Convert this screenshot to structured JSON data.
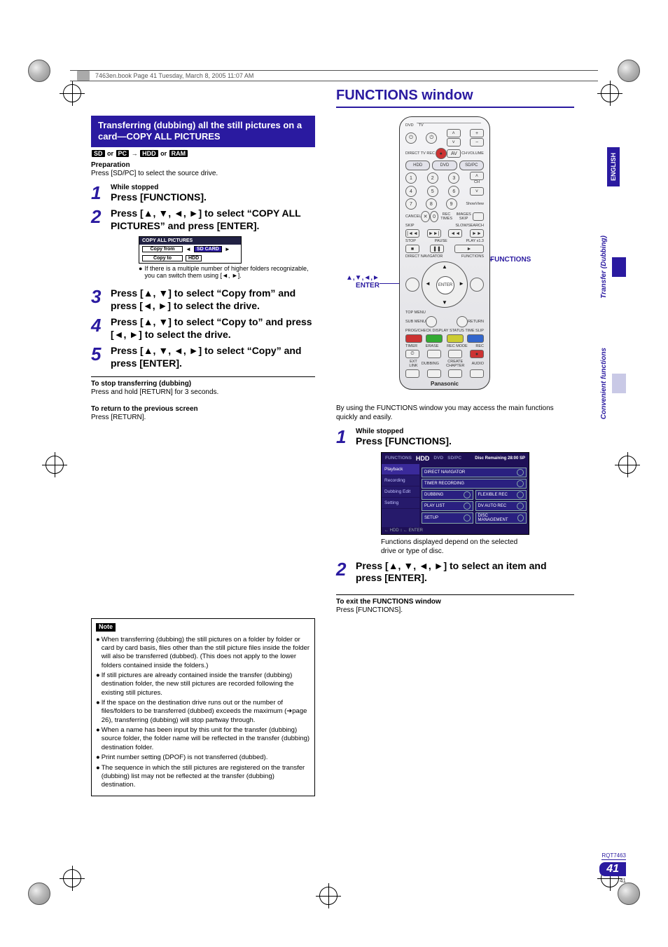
{
  "printer_header": "7463en.book  Page 41  Tuesday, March 8, 2005  11:07 AM",
  "side_tabs": {
    "english": "ENGLISH",
    "tab1": "Transfer (Dubbing)",
    "tab2": "Convenient functions"
  },
  "page_marker": {
    "code": "RQT7463",
    "big": "41",
    "small": "41"
  },
  "left": {
    "banner": "Transferring (dubbing) all the still pictures on a card—COPY ALL PICTURES",
    "tags_prefix": "",
    "tag_sd": "SD",
    "tag_or1": " or ",
    "tag_pc": "PC",
    "arrow": " → ",
    "tag_hdd": "HDD",
    "tag_or2": " or ",
    "tag_ram": "RAM",
    "prep_head": "Preparation",
    "prep_body": "Press [SD/PC] to select the source drive.",
    "steps": [
      {
        "num": "1",
        "small": "While stopped",
        "main": "Press [FUNCTIONS]."
      },
      {
        "num": "2",
        "main": "Press [▲, ▼, ◄, ►] to select “COPY ALL PICTURES” and press [ENTER]."
      },
      {
        "num": "3",
        "main": "Press [▲, ▼] to select “Copy from” and press [◄, ►] to select the drive."
      },
      {
        "num": "4",
        "main": "Press [▲, ▼] to select “Copy to” and press [◄, ►] to select the drive."
      },
      {
        "num": "5",
        "main": "Press [▲, ▼, ◄, ►] to select “Copy” and press [ENTER]."
      }
    ],
    "mini_screen": {
      "title": "COPY ALL PICTURES",
      "row1_label": "Copy from",
      "row1_val": "SD CARD",
      "row2_label": "Copy to",
      "row2_val": "HDD"
    },
    "mini_note": "If there is a multiple number of higher folders recognizable, you can switch them using [◄, ►].",
    "stop_head": "To stop transferring (dubbing)",
    "stop_body": "Press and hold [RETURN] for 3 seconds.",
    "return_head": "To return to the previous screen",
    "return_body": "Press [RETURN].",
    "note_label": "Note",
    "notes": [
      "When transferring (dubbing) the still pictures on a folder by folder or card by card basis, files other than the still picture files inside the folder will also be transferred (dubbed). (This does not apply to the lower folders contained inside the folders.)",
      "If still pictures are already contained inside the transfer (dubbing) destination folder, the new still pictures are recorded following the existing still pictures.",
      "If the space on the destination drive runs out or the number of files/folders to be transferred (dubbed) exceeds the maximum (➔page 26), transferring (dubbing) will stop partway through.",
      "When a name has been input by this unit for the transfer (dubbing) source folder, the folder name will be reflected in the transfer (dubbing) destination folder.",
      "Print number setting (DPOF) is not transferred (dubbed).",
      "The sequence in which the still pictures are registered on the transfer (dubbing) list may not be reflected at the transfer (dubbing) destination."
    ]
  },
  "right": {
    "title": "FUNCTIONS window",
    "remote": {
      "dvd": "DVD",
      "tv": "TV",
      "hdd": "HDD",
      "dvd_btn": "DVD",
      "sdpc": "SD/PC",
      "cancel": "CANCEL",
      "showview": "ShowView",
      "rec": "REC",
      "skip": "SKIP",
      "slow": "SLOW/SEARCH",
      "stop": "STOP",
      "pause": "PAUSE",
      "play": "PLAY x1.3",
      "dn": "DIRECT NAVIGATOR",
      "func": "FUNCTIONS",
      "topmenu": "TOP MENU",
      "enter": "ENTER",
      "submenu": "SUB MENU",
      "return": "RETURN",
      "progcheck": "PROG/CHECK",
      "display": "DISPLAY",
      "status": "STATUS",
      "timeslip": "TIME SLIP",
      "timer": "TIMER",
      "erase": "ERASE",
      "recmode": "REC MODE",
      "rec2": "REC",
      "extlink": "EXT LINK",
      "dubbing": "DUBBING",
      "create": "CREATE CHAPTER",
      "audio": "AUDIO",
      "brand": "Panasonic",
      "volume": "VOLUME",
      "ch": "CH",
      "av": "AV",
      "direct": "DIRECT TV REC",
      "images": "IMAGES SKIP",
      "rectimes": "REC TIMES"
    },
    "callout_func": "FUNCTIONS",
    "callout_nav": "▲,▼,◄,►\nENTER",
    "intro": "By using the FUNCTIONS window you may access the main functions quickly and easily.",
    "steps": [
      {
        "num": "1",
        "small": "While stopped",
        "main": "Press [FUNCTIONS]."
      },
      {
        "num": "2",
        "main": "Press [▲, ▼, ◄, ►] to select an item and press [ENTER]."
      }
    ],
    "screen_note": "Functions displayed depend on the selected drive or type of disc.",
    "func_screen": {
      "header_tab1": "FUNCTIONS",
      "sel": "HDD",
      "dim1": "DVD",
      "dim2": "SD/PC",
      "remain": "Disc Remaining  28:00 SP",
      "side": [
        "Playback",
        "Recording",
        "Dubbing Edit",
        "Setting"
      ],
      "rows": [
        [
          "DIRECT NAVIGATOR"
        ],
        [
          "TIMER RECORDING"
        ],
        [
          "DUBBING",
          "FLEXIBLE REC"
        ],
        [
          "PLAY LIST",
          "DV AUTO REC"
        ],
        [
          "SETUP",
          "DISC MANAGEMENT"
        ]
      ],
      "foot": "← HDD                            ↕  ← ENTER"
    },
    "exit_head": "To exit the FUNCTIONS window",
    "exit_body": "Press [FUNCTIONS]."
  }
}
